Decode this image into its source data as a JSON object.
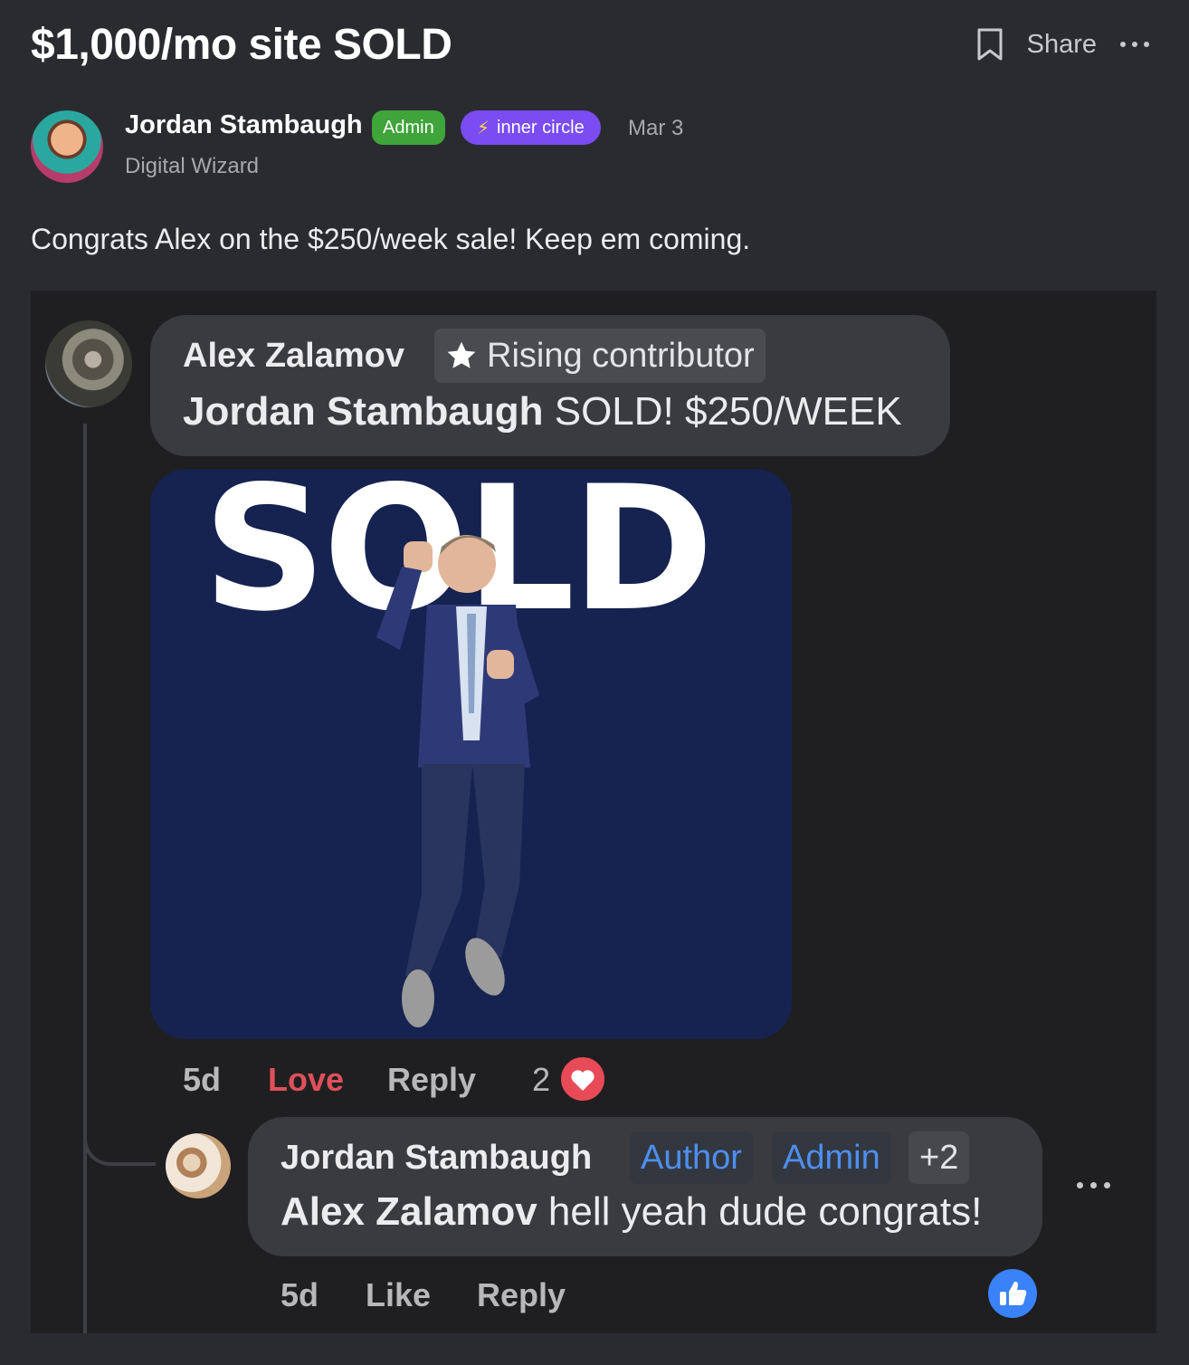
{
  "post": {
    "title": "$1,000/mo site SOLD",
    "share_label": "Share",
    "author_name": "Jordan Stambaugh",
    "author_subtitle": "Digital Wizard",
    "admin_badge": "Admin",
    "inner_circle_badge": "inner circle",
    "date": "Mar 3",
    "body": "Congrats Alex on the $250/week sale! Keep em coming."
  },
  "comment": {
    "author": "Alex Zalamov",
    "badge": "Rising contributor",
    "mention": "Jordan Stambaugh",
    "text": " SOLD! $250/WEEK",
    "image_text": "SOLD",
    "time": "5d",
    "love_label": "Love",
    "reply_label": "Reply",
    "reaction_count": "2"
  },
  "reply": {
    "author": "Jordan Stambaugh",
    "tags": [
      "Author",
      "Admin",
      "+2"
    ],
    "mention": "Alex Zalamov",
    "text": " hell yeah dude congrats!",
    "time": "5d",
    "like_label": "Like",
    "reply_label": "Reply"
  },
  "icons": {
    "bookmark": "bookmark-icon",
    "more": "more-dots-icon",
    "star": "star-icon",
    "bolt": "lightning-icon",
    "heart": "heart-icon",
    "like": "thumbs-up-icon"
  },
  "colors": {
    "background": "#2a2b2f",
    "admin_green": "#3fa43a",
    "inner_circle_purple": "#7a4cf2",
    "love_red": "#e0505a",
    "tag_blue": "#4d8ff0",
    "like_blue": "#3a82f7"
  }
}
